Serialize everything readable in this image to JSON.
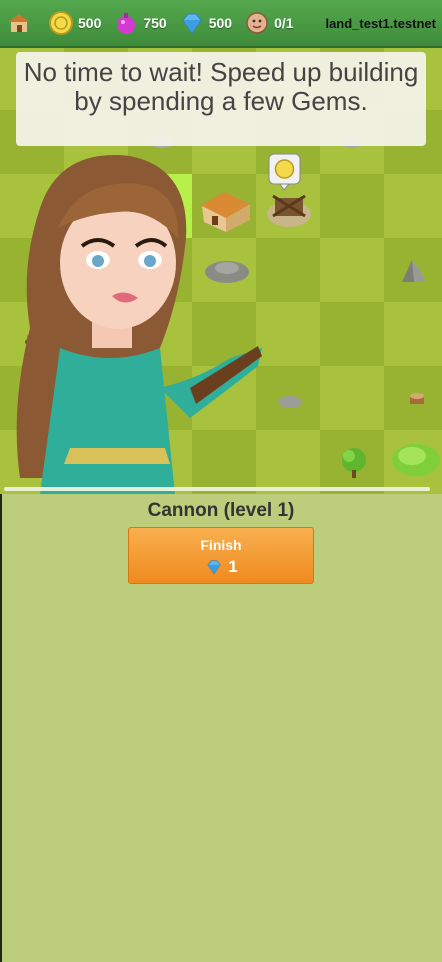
{
  "topbar": {
    "resources": [
      {
        "icon": "house-icon",
        "value": ""
      },
      {
        "icon": "gold-coin-icon",
        "value": "500"
      },
      {
        "icon": "elixir-potion-icon",
        "value": "750"
      },
      {
        "icon": "gem-icon",
        "value": "500"
      },
      {
        "icon": "builder-icon",
        "value": "0/1"
      }
    ],
    "land_name": "land_test1.testnet"
  },
  "tooltip": "No time to wait! Speed up building by spending a few Gems.",
  "panel": {
    "building_title": "Cannon (level 1)",
    "finish_label": "Finish",
    "gem_cost": "1"
  },
  "colors": {
    "grass_light": "#a9c23e",
    "grass_dark": "#98b232",
    "button_orange": "#f39a2a",
    "panel_bg": "#bccd7c",
    "topbar_green": "#4a9c45"
  }
}
